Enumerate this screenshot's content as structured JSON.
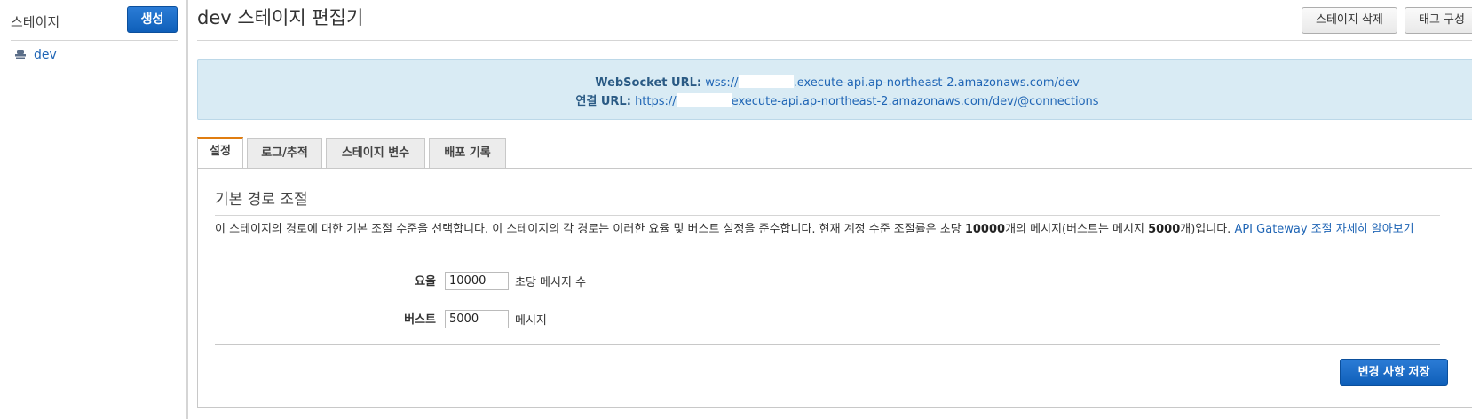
{
  "sidebar": {
    "title": "스테이지",
    "create_label": "생성",
    "items": [
      {
        "label": "dev",
        "icon": "stage-icon"
      }
    ]
  },
  "header": {
    "title": "dev 스테이지 편집기",
    "delete_label": "스테이지 삭제",
    "tag_label": "태그 구성"
  },
  "banner": {
    "ws_label": "WebSocket URL:",
    "ws_prefix": "wss://",
    "ws_suffix": ".execute-api.ap-northeast-2.amazonaws.com/dev",
    "conn_label": "연결 URL:",
    "conn_prefix": "https://",
    "conn_suffix": "execute-api.ap-northeast-2.amazonaws.com/dev/@connections"
  },
  "tabs": [
    {
      "label": "설정",
      "active": true
    },
    {
      "label": "로그/추적",
      "active": false
    },
    {
      "label": "스테이지 변수",
      "active": false
    },
    {
      "label": "배포 기록",
      "active": false
    }
  ],
  "throttling": {
    "title": "기본 경로 조절",
    "desc_part1": "이 스테이지의 경로에 대한 기본 조절 수준을 선택합니다. 이 스테이지의 각 경로는 이러한 요율 및 버스트 설정을 준수합니다. 현재 계정 수준 조절률은 초당 ",
    "desc_rate": "10000",
    "desc_part2": "개의 메시지(버스트는 메시지 ",
    "desc_burst": "5000",
    "desc_part3": "개)입니다. ",
    "desc_link": "API Gateway 조절 자세히 알아보기",
    "rate_label": "요율",
    "rate_value": "10000",
    "rate_unit": "초당 메시지 수",
    "burst_label": "버스트",
    "burst_value": "5000",
    "burst_unit": "메시지"
  },
  "footer": {
    "save_label": "변경 사항 저장"
  },
  "colors": {
    "accent": "#1f65b5",
    "tab_active": "#e07d10",
    "banner_bg": "#d9ebf4"
  }
}
